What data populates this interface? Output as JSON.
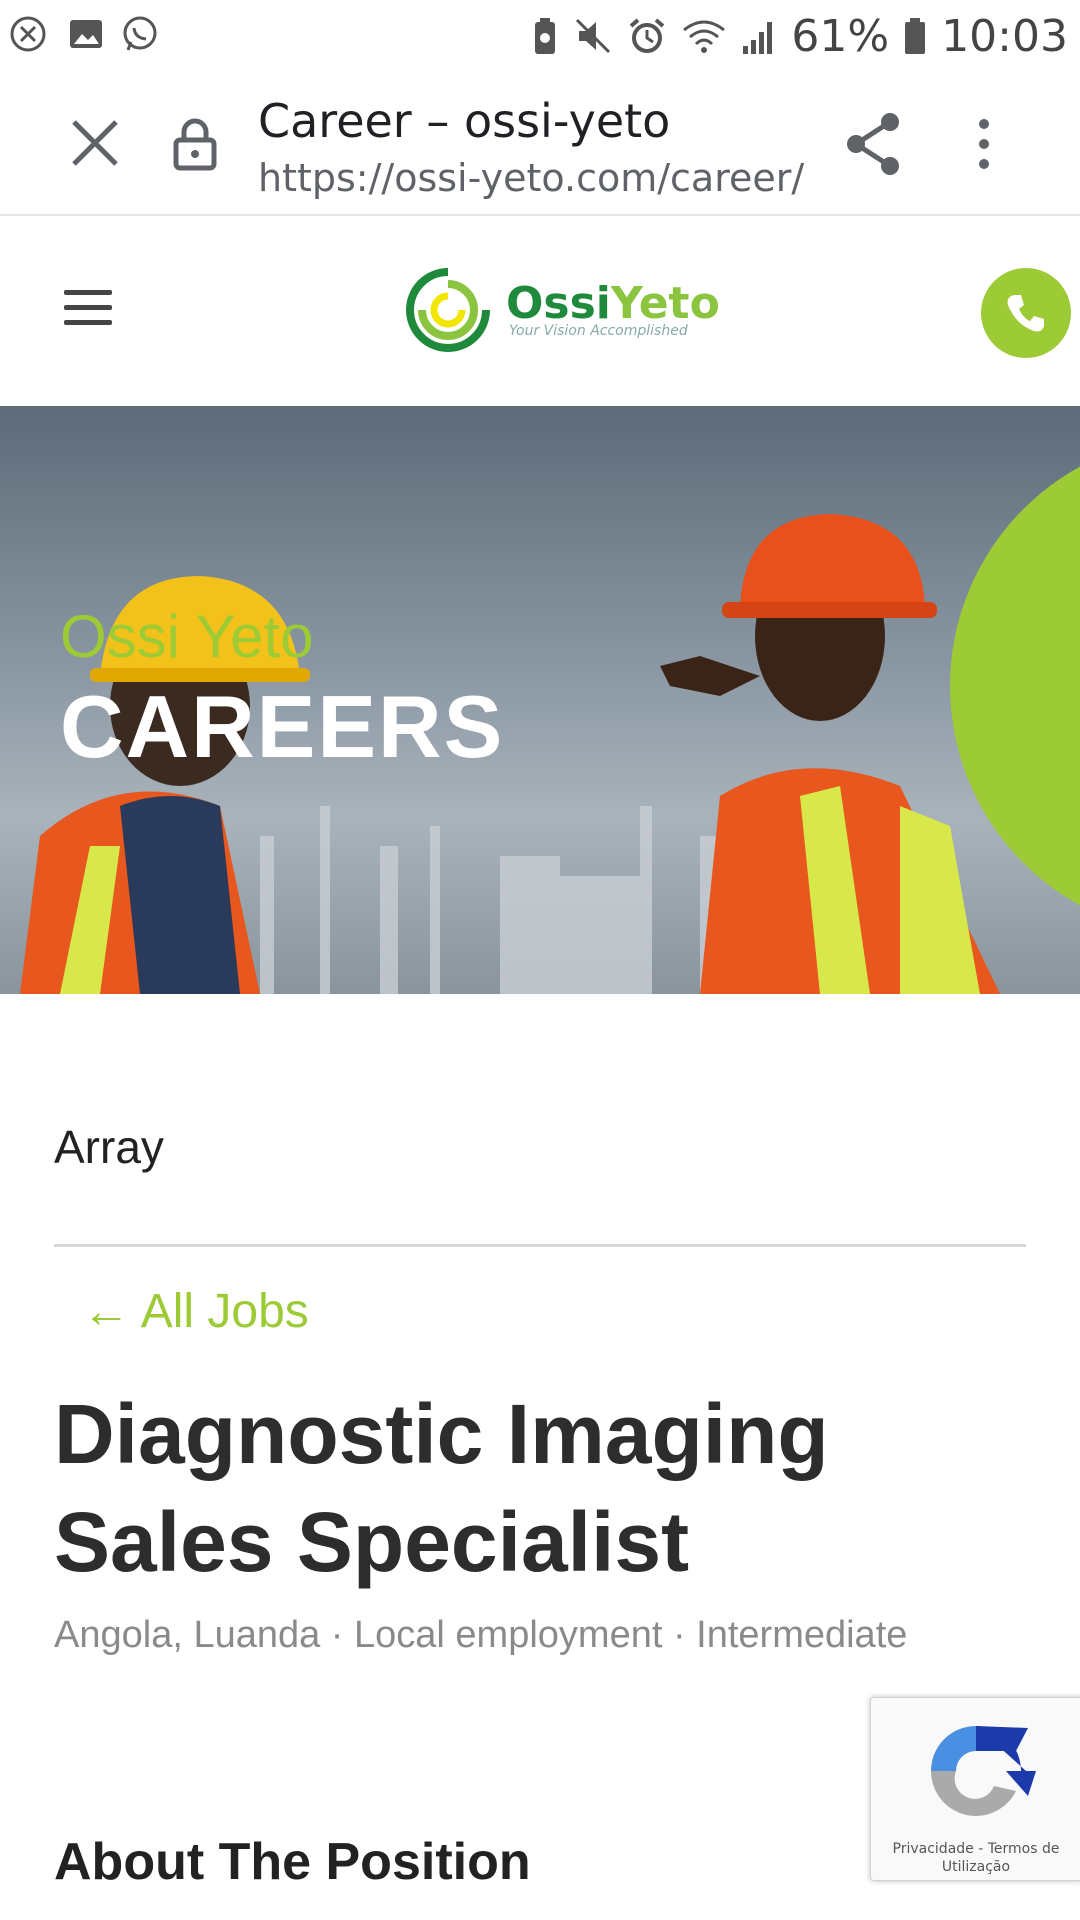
{
  "status_bar": {
    "battery": "61%",
    "time": "10:03",
    "icons": [
      "close-circle-icon",
      "image-icon",
      "whatsapp-icon",
      "battery-saver-icon",
      "mute-icon",
      "alarm-icon",
      "wifi-icon",
      "signal-icon",
      "battery-icon"
    ]
  },
  "browser": {
    "title": "Career – ossi-yeto",
    "url": "https://ossi-yeto.com/career/co",
    "icons": [
      "close-icon",
      "lock-icon",
      "share-icon",
      "more-vert-icon"
    ]
  },
  "header": {
    "logo_ossi": "Ossi",
    "logo_yeto": "Yeto",
    "logo_tagline": "Your Vision Accomplished",
    "icons": [
      "menu-icon",
      "phone-icon"
    ],
    "accent": "#9dcb36"
  },
  "hero": {
    "subtitle": "Ossi Yeto",
    "title": "CAREERS"
  },
  "content": {
    "array_text": "Array",
    "all_jobs": "← All Jobs",
    "job_title": "Diagnostic Imaging Sales Specialist",
    "job_meta": "Angola, Luanda · Local employment · Intermediate",
    "section_heading": "About The Position"
  },
  "recaptcha": {
    "privacy": "Privacidade",
    "separator": " - ",
    "terms": "Termos de Utilização"
  }
}
